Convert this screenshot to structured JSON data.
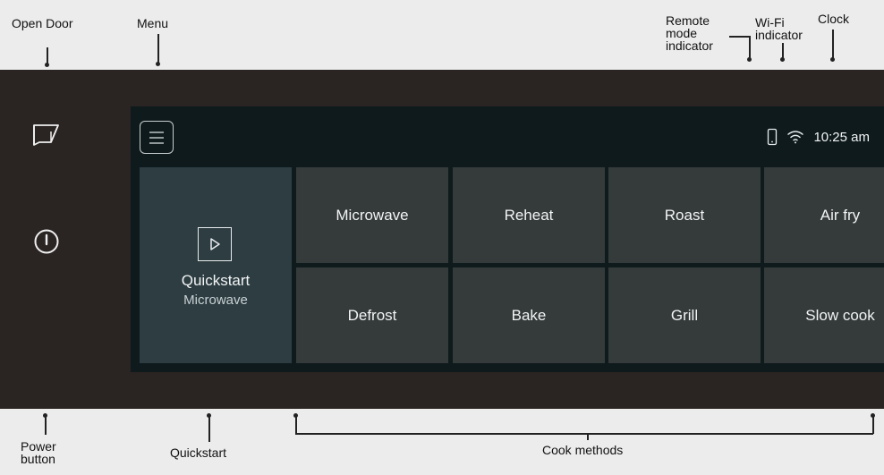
{
  "callouts": {
    "open_door": "Open Door",
    "menu": "Menu",
    "remote_mode": "Remote\nmode\nindicator",
    "wifi": "Wi-Fi\nindicator",
    "clock": "Clock",
    "power_button": "Power\nbutton",
    "quickstart": "Quickstart",
    "cook_methods": "Cook methods"
  },
  "screen": {
    "time": "10:25 am",
    "quickstart": {
      "title": "Quickstart",
      "subtitle": "Microwave"
    },
    "cook_methods": [
      {
        "label": "Microwave"
      },
      {
        "label": "Reheat"
      },
      {
        "label": "Roast"
      },
      {
        "label": "Air fry"
      },
      {
        "label": "Defrost"
      },
      {
        "label": "Bake"
      },
      {
        "label": "Grill"
      },
      {
        "label": "Slow cook"
      }
    ]
  },
  "icons": {
    "open_door": "open-door-icon",
    "power": "power-icon",
    "menu": "hamburger-menu-icon",
    "remote": "phone-icon",
    "wifi": "wifi-icon",
    "play": "play-icon"
  },
  "colors": {
    "device_body": "#2a2422",
    "screen_background": "#0f1a1c",
    "quickstart_tile": "#2d3d42",
    "method_tile": "#353a3b",
    "text": "#f2f4f5"
  }
}
